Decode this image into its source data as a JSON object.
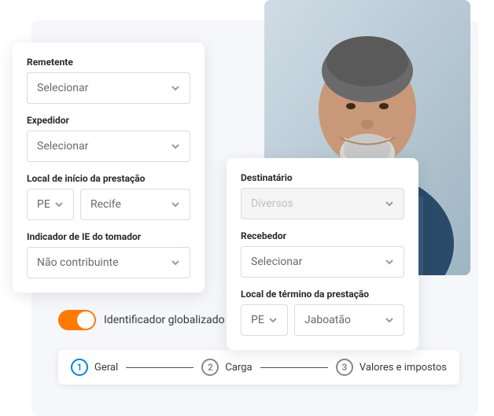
{
  "leftForm": {
    "remetente": {
      "label": "Remetente",
      "value": "Selecionar"
    },
    "expedidor": {
      "label": "Expedidor",
      "value": "Selecionar"
    },
    "localInicio": {
      "label": "Local de início da prestação",
      "state": "PE",
      "city": "Recife"
    },
    "indicadorIe": {
      "label": "Indicador de IE do tomador",
      "value": "Não contribuinte"
    }
  },
  "rightForm": {
    "destinatario": {
      "label": "Destinatário",
      "value": "Diversos"
    },
    "recebedor": {
      "label": "Recebedor",
      "value": "Selecionar"
    },
    "localTermino": {
      "label": "Local de término da prestação",
      "state": "PE",
      "city": "Jaboatão"
    }
  },
  "toggle": {
    "label": "Identificador globalizado",
    "active": true
  },
  "stepper": {
    "steps": [
      {
        "num": "1",
        "label": "Geral"
      },
      {
        "num": "2",
        "label": "Carga"
      },
      {
        "num": "3",
        "label": "Valores e impostos"
      }
    ]
  }
}
